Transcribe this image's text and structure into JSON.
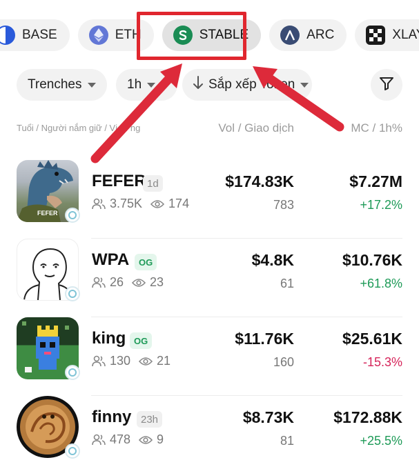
{
  "chains": [
    {
      "label": "BASE",
      "icon": "base-icon"
    },
    {
      "label": "ETH",
      "icon": "eth-icon"
    },
    {
      "label": "STABLE",
      "icon": "stable-icon",
      "active": true
    },
    {
      "label": "ARC",
      "icon": "arc-icon"
    },
    {
      "label": "XLAYER",
      "icon": "xlayer-icon"
    }
  ],
  "filters": {
    "trenches": "Trenches",
    "timeframe": "1h",
    "sort": "Sắp xếp Token"
  },
  "columns": {
    "left": "Tuổi / Người nắm giữ / Vị trí ng",
    "middle": "Vol / Giao dịch",
    "right": "MC / 1h%"
  },
  "tokens": [
    {
      "name": "FEFER",
      "tag": "1d",
      "holders": "3.75K",
      "views": "174",
      "vol": "$174.83K",
      "txs": "783",
      "mc": "$7.27M",
      "change": "+17.2%",
      "trend": "up",
      "avatar_text": "FEFER"
    },
    {
      "name": "WPA",
      "tag": "OG",
      "holders": "26",
      "views": "23",
      "vol": "$4.8K",
      "txs": "61",
      "mc": "$10.76K",
      "change": "+61.8%",
      "trend": "up"
    },
    {
      "name": "king",
      "tag": "OG",
      "holders": "130",
      "views": "21",
      "vol": "$11.76K",
      "txs": "160",
      "mc": "$25.61K",
      "change": "-15.3%",
      "trend": "down"
    },
    {
      "name": "finny",
      "tag": "23h",
      "holders": "478",
      "views": "9",
      "vol": "$8.73K",
      "txs": "81",
      "mc": "$172.88K",
      "change": "+25.5%",
      "trend": "up"
    }
  ],
  "colors": {
    "up": "#1d9a57",
    "down": "#d6245a",
    "highlight": "#e0262e",
    "arrow": "#dd2a3a"
  }
}
